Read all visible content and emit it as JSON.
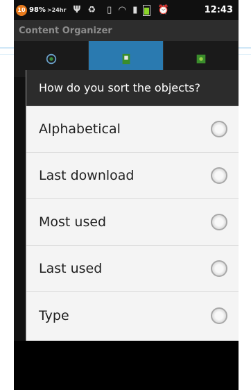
{
  "status_bar": {
    "battery_badge": "10",
    "battery_percent": "98%",
    "timer": ">24hr",
    "time": "12:43",
    "icons": [
      "usb-icon",
      "recycle-icon",
      "vibrate-icon",
      "wifi-icon",
      "signal-icon",
      "battery-icon",
      "alarm-icon"
    ]
  },
  "app": {
    "title": "Content Organizer"
  },
  "tabs": [
    {
      "icon": "refresh-icon",
      "active": false
    },
    {
      "icon": "bookmark-icon",
      "active": true
    },
    {
      "icon": "android-icon",
      "active": false
    }
  ],
  "dialog": {
    "title": "How do you sort the objects?",
    "options": [
      {
        "label": "Alphabetical",
        "selected": false
      },
      {
        "label": "Last download",
        "selected": false
      },
      {
        "label": "Most used",
        "selected": false
      },
      {
        "label": "Last used",
        "selected": false
      },
      {
        "label": "Type",
        "selected": false
      }
    ]
  },
  "colors": {
    "tab_active": "#2a7ab0",
    "battery_badge": "#e87a1c",
    "battery_fill": "#8bd52a"
  }
}
